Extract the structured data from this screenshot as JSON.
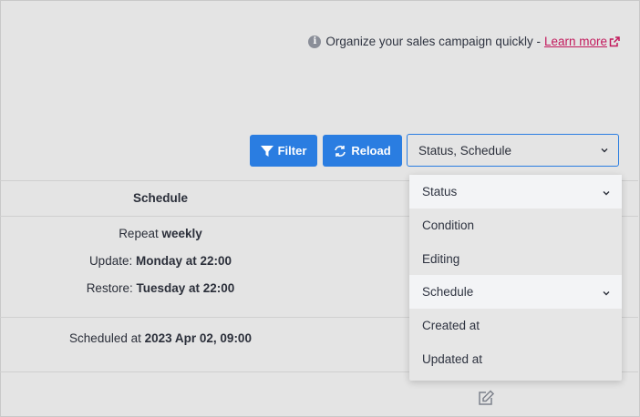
{
  "hint": {
    "text": "Organize your sales campaign quickly -",
    "link": "Learn more"
  },
  "toolbar": {
    "filter_label": "Filter",
    "reload_label": "Reload",
    "columns_select_value": "Status, Schedule"
  },
  "table": {
    "column_schedule": "Schedule",
    "row1": {
      "repeat_label": "Repeat",
      "repeat_value": "weekly",
      "update_label": "Update:",
      "update_value": "Monday at 22:00",
      "restore_label": "Restore:",
      "restore_value": "Tuesday at 22:00"
    },
    "row2": {
      "scheduled_label": "Scheduled at",
      "scheduled_value": "2023 Apr 02, 09:00"
    }
  },
  "dropdown": {
    "options": [
      {
        "label": "Status",
        "selected": true
      },
      {
        "label": "Condition",
        "selected": false
      },
      {
        "label": "Editing",
        "selected": false
      },
      {
        "label": "Schedule",
        "selected": true
      },
      {
        "label": "Created at",
        "selected": false
      },
      {
        "label": "Updated at",
        "selected": false
      }
    ]
  },
  "colors": {
    "primary": "#2a7de1",
    "link": "#c2185b",
    "background": "#e4e4e4"
  }
}
